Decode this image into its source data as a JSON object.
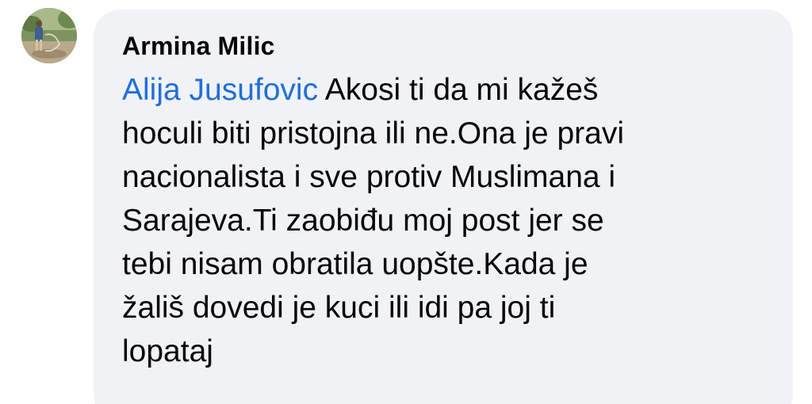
{
  "comment": {
    "avatar_icon": "profile-photo-avatar",
    "author": "Armina Milic",
    "mention": "Alija Jusufovic",
    "lines": [
      " Akosi ti da mi kažeš",
      "hoculi biti pristojna ili ne.Ona je pravi",
      "nacionalista i sve protiv Muslimana i",
      "Sarajeva.Ti zaobiđu moj post jer se",
      "tebi nisam obratila uopšte.Kada je",
      "žališ dovedi je kuci ili idi pa joj ti",
      "lopataj"
    ]
  },
  "colors": {
    "bubble_bg": "#f0f2f5",
    "text": "#050505",
    "mention": "#216fdb"
  }
}
